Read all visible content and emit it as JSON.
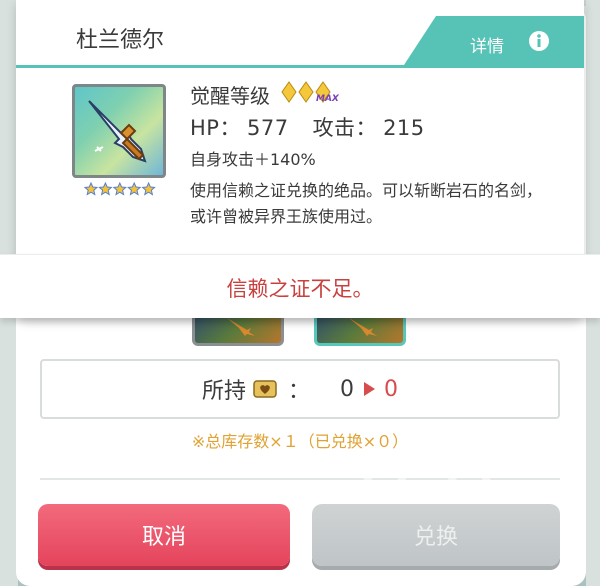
{
  "dialog": {
    "title": "杜兰德尔",
    "detail_label": "详情",
    "awaken_label": "觉醒等级",
    "awaken_badge": "MAX",
    "hp_label": "HP：",
    "hp_value": "577",
    "atk_label": "攻击：",
    "atk_value": "215",
    "self_atk": "自身攻击＋140%",
    "description": "使用信赖之证兑换的绝品。可以斩断岩石的名剑，或许曾被异界王族使用过。",
    "rarity_stars": 5
  },
  "notice": {
    "text": "信赖之证不足。"
  },
  "owned": {
    "label": "所持",
    "colon": "：",
    "current": "0",
    "after": "0"
  },
  "stock_note": "※总库存数×１（已兑换×０）",
  "buttons": {
    "cancel": "取消",
    "exchange": "兑换"
  },
  "watermark": "blublu",
  "colors": {
    "accent": "#56c3b6",
    "cancel": "#e4445c",
    "disabled": "#c4c8ca",
    "warning": "#c8413f",
    "note": "#e0a232",
    "star": "#f2c33a"
  }
}
